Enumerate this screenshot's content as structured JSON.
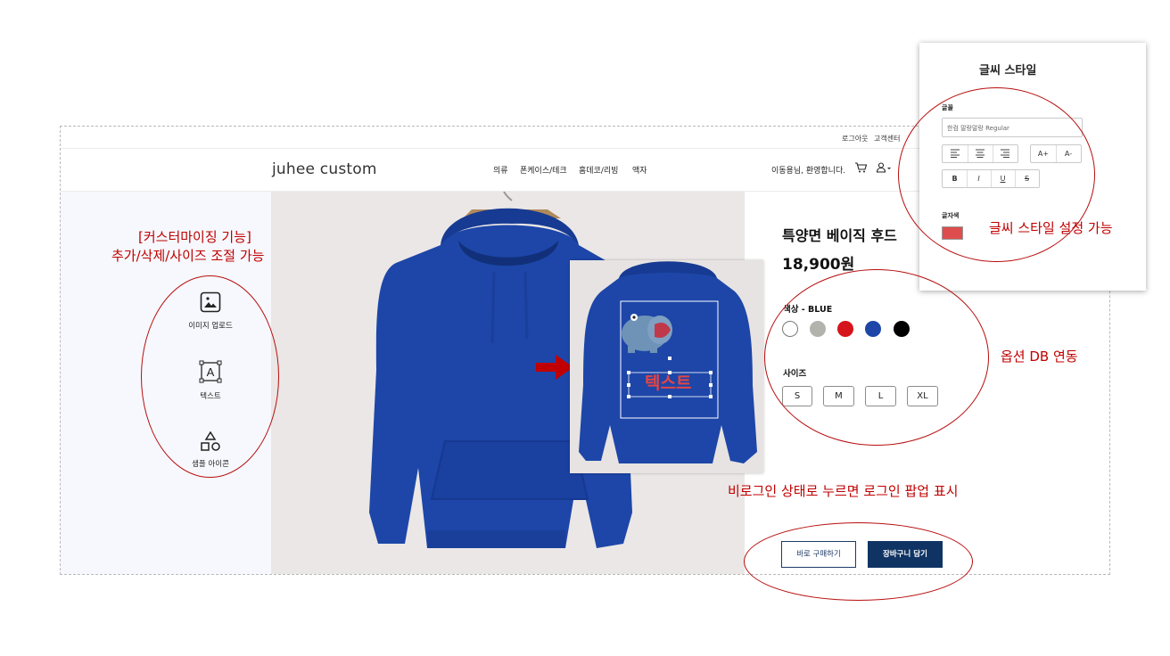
{
  "header": {
    "top_links": [
      "로그아웃",
      "고객센터"
    ],
    "logo": "juhee custom",
    "nav": [
      "의류",
      "폰케이스/테크",
      "홈데코/리빙",
      "액자"
    ],
    "greeting": "이동용님, 환영합니다."
  },
  "tools": [
    {
      "label": "이미지 업로드",
      "icon": "image-icon"
    },
    {
      "label": "텍스트",
      "icon": "text-tool-icon"
    },
    {
      "label": "샘플 아이콘",
      "icon": "shapes-icon"
    }
  ],
  "preview": {
    "overlay_text": "텍스트"
  },
  "product": {
    "title": "특양면 베이직 후드",
    "price": "18,900원",
    "color_label": "색상 - BLUE",
    "colors": [
      "#ffffff",
      "#b3b3ae",
      "#d5141b",
      "#1d46a8",
      "#000000"
    ],
    "selected_color": "#1d46a8",
    "size_label": "사이즈",
    "sizes": [
      "S",
      "M",
      "L",
      "XL"
    ],
    "buy_now": "바로 구매하기",
    "add_to_cart": "장바구니 담기"
  },
  "style_panel": {
    "title": "글씨 스타일",
    "font_label": "글꼴",
    "font_value": "한컴 말랑말랑 Regular",
    "align_buttons": [
      "left",
      "center",
      "right"
    ],
    "size_buttons": [
      "A+",
      "A-"
    ],
    "format_buttons": [
      "B",
      "I",
      "U",
      "S"
    ],
    "color_label": "글자색",
    "text_color": "#dd4d4d"
  },
  "annotations": {
    "customize_title": "[커스터마이징 기능]",
    "customize_desc": "추가/삭제/사이즈 조절 가능",
    "style": "글씨 스타일 설정 가능",
    "options": "옵션 DB 연동",
    "login": "비로그인 상태로 누르면 로그인 팝업 표시"
  },
  "colors": {
    "accent": "#0f3463",
    "annotation": "#c00000",
    "hoodie": "#1d46a8"
  }
}
